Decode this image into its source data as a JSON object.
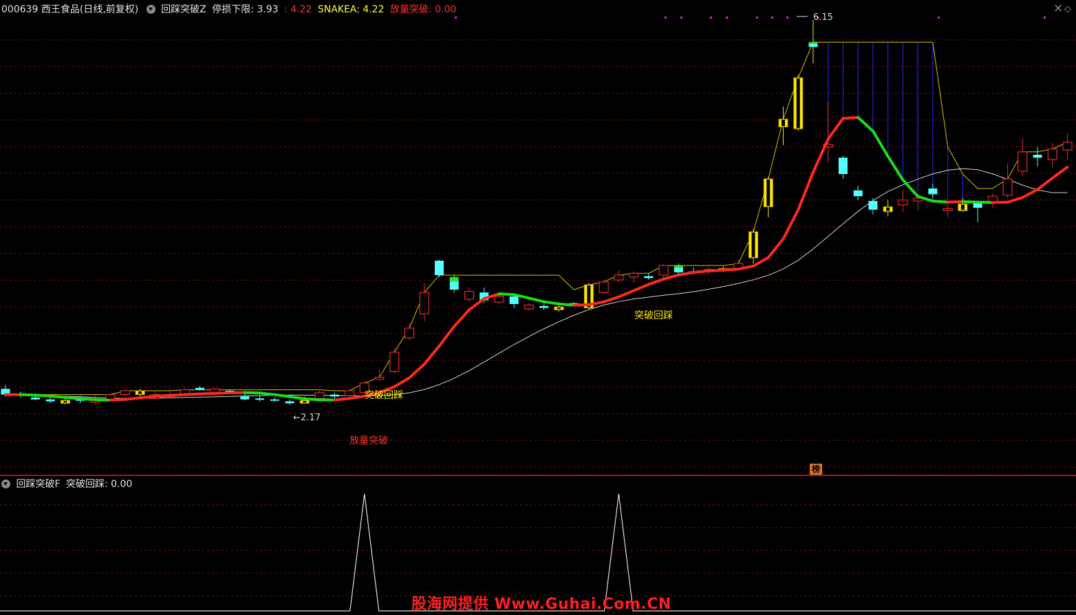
{
  "header": {
    "stock": "000639 西王食品(日线,前复权)",
    "indicator_name": "回踩突破Z",
    "stop_label": "停损下限: 3.93",
    "stop_value": ": 4.22",
    "snake_label": "SNAKEA: 4.22",
    "volume_break_label": "放量突破: 0.00"
  },
  "controls": {
    "close_icon": "×",
    "diamond_icon": "◇"
  },
  "chart_labels": {
    "high_price": "6.15",
    "low_price": "2.17",
    "break_pullback_1": "突破回踩",
    "break_pullback_2": "突破回踩",
    "volume_breakout": "放量突破"
  },
  "badge": "榜",
  "sub_header": {
    "indicator_name": "回踩突破F",
    "value_label": "突破回踩: 0.00"
  },
  "watermark": "股海网提供 Www.Guhai.Com.CN",
  "colors": {
    "up_candle": "#e8282d",
    "down_candle": "#54ffff",
    "signal_yellow": "#ffea00",
    "signal_green": "#20e830",
    "snake_red": "#ff2a1a",
    "snake_green": "#18e018",
    "slow_line": "#d8d8d8",
    "stop_line": "#d8c400",
    "fill_blue": "#2424d8",
    "grid": "#7a0f12",
    "watermark": "#ff2020"
  },
  "chart_data": {
    "type": "candlestick",
    "series": [
      {
        "name": "停损下限"
      },
      {
        "name": "SNAKEA"
      },
      {
        "name": "放量突破"
      },
      {
        "name": "突破回踩"
      }
    ],
    "annotations": {
      "max": 6.15,
      "min": 2.17
    },
    "candles": [
      {
        "o": 2.32,
        "h": 2.36,
        "l": 2.24,
        "c": 2.26,
        "k": "d"
      },
      {
        "o": 2.27,
        "h": 2.29,
        "l": 2.23,
        "c": 2.26,
        "k": "d"
      },
      {
        "o": 2.23,
        "h": 2.26,
        "l": 2.2,
        "c": 2.21,
        "k": "d"
      },
      {
        "o": 2.21,
        "h": 2.23,
        "l": 2.17,
        "c": 2.19,
        "k": "d"
      },
      {
        "o": 2.2,
        "h": 2.23,
        "l": 2.16,
        "c": 2.17,
        "k": "y"
      },
      {
        "o": 2.21,
        "h": 2.22,
        "l": 2.17,
        "c": 2.2,
        "k": "d"
      },
      {
        "o": 2.18,
        "h": 2.23,
        "l": 2.16,
        "c": 2.21,
        "k": "u"
      },
      {
        "o": 2.21,
        "h": 2.27,
        "l": 2.2,
        "c": 2.26,
        "k": "u"
      },
      {
        "o": 2.26,
        "h": 2.32,
        "l": 2.25,
        "c": 2.3,
        "k": "u"
      },
      {
        "o": 2.3,
        "h": 2.32,
        "l": 2.24,
        "c": 2.26,
        "k": "y"
      },
      {
        "o": 2.26,
        "h": 2.27,
        "l": 2.21,
        "c": 2.22,
        "k": "u"
      },
      {
        "o": 2.24,
        "h": 2.28,
        "l": 2.22,
        "c": 2.26,
        "k": "u"
      },
      {
        "o": 2.26,
        "h": 2.33,
        "l": 2.25,
        "c": 2.31,
        "k": "u"
      },
      {
        "o": 2.33,
        "h": 2.35,
        "l": 2.3,
        "c": 2.31,
        "k": "d"
      },
      {
        "o": 2.32,
        "h": 2.33,
        "l": 2.25,
        "c": 2.27,
        "k": "u"
      },
      {
        "o": 2.29,
        "h": 2.31,
        "l": 2.27,
        "c": 2.3,
        "k": "d"
      },
      {
        "o": 2.24,
        "h": 2.27,
        "l": 2.2,
        "c": 2.21,
        "k": "d"
      },
      {
        "o": 2.22,
        "h": 2.25,
        "l": 2.19,
        "c": 2.21,
        "k": "d"
      },
      {
        "o": 2.21,
        "h": 2.23,
        "l": 2.19,
        "c": 2.2,
        "k": "d"
      },
      {
        "o": 2.19,
        "h": 2.21,
        "l": 2.15,
        "c": 2.17,
        "k": "d"
      },
      {
        "o": 2.2,
        "h": 2.24,
        "l": 2.17,
        "c": 2.17,
        "k": "y"
      },
      {
        "o": 2.22,
        "h": 2.3,
        "l": 2.2,
        "c": 2.28,
        "k": "u"
      },
      {
        "o": 2.24,
        "h": 2.28,
        "l": 2.22,
        "c": 2.26,
        "k": "d"
      },
      {
        "o": 2.25,
        "h": 2.32,
        "l": 2.24,
        "c": 2.3,
        "k": "u"
      },
      {
        "o": 2.28,
        "h": 2.4,
        "l": 2.27,
        "c": 2.38,
        "k": "u"
      },
      {
        "o": 2.42,
        "h": 2.52,
        "l": 2.4,
        "c": 2.44,
        "k": "u"
      },
      {
        "o": 2.5,
        "h": 2.74,
        "l": 2.48,
        "c": 2.7,
        "k": "u"
      },
      {
        "o": 2.85,
        "h": 3.0,
        "l": 2.82,
        "c": 2.95,
        "k": "u"
      },
      {
        "o": 3.1,
        "h": 3.42,
        "l": 3.02,
        "c": 3.32,
        "k": "u"
      },
      {
        "o": 3.65,
        "h": 3.66,
        "l": 3.48,
        "c": 3.5,
        "k": "d"
      },
      {
        "o": 3.48,
        "h": 3.5,
        "l": 3.32,
        "c": 3.35,
        "k": "g"
      },
      {
        "o": 3.33,
        "h": 3.37,
        "l": 3.22,
        "c": 3.25,
        "k": "u"
      },
      {
        "o": 3.32,
        "h": 3.37,
        "l": 3.21,
        "c": 3.24,
        "k": "d"
      },
      {
        "o": 3.28,
        "h": 3.3,
        "l": 3.2,
        "c": 3.22,
        "k": "u"
      },
      {
        "o": 3.28,
        "h": 3.3,
        "l": 3.16,
        "c": 3.2,
        "k": "d"
      },
      {
        "o": 3.15,
        "h": 3.21,
        "l": 3.13,
        "c": 3.19,
        "k": "u"
      },
      {
        "o": 3.18,
        "h": 3.22,
        "l": 3.14,
        "c": 3.16,
        "k": "d"
      },
      {
        "o": 3.17,
        "h": 3.2,
        "l": 3.12,
        "c": 3.14,
        "k": "y"
      },
      {
        "o": 3.19,
        "h": 3.22,
        "l": 3.18,
        "c": 3.21,
        "k": "d"
      },
      {
        "o": 3.16,
        "h": 3.42,
        "l": 3.15,
        "c": 3.4,
        "k": "y"
      },
      {
        "o": 3.32,
        "h": 3.45,
        "l": 3.3,
        "c": 3.43,
        "k": "u"
      },
      {
        "o": 3.45,
        "h": 3.55,
        "l": 3.42,
        "c": 3.5,
        "k": "u"
      },
      {
        "o": 3.48,
        "h": 3.54,
        "l": 3.42,
        "c": 3.52,
        "k": "u"
      },
      {
        "o": 3.49,
        "h": 3.52,
        "l": 3.45,
        "c": 3.47,
        "k": "d"
      },
      {
        "o": 3.5,
        "h": 3.62,
        "l": 3.46,
        "c": 3.6,
        "k": "u"
      },
      {
        "o": 3.53,
        "h": 3.62,
        "l": 3.5,
        "c": 3.6,
        "k": "g"
      },
      {
        "o": 3.54,
        "h": 3.58,
        "l": 3.51,
        "c": 3.53,
        "k": "d"
      },
      {
        "o": 3.56,
        "h": 3.58,
        "l": 3.51,
        "c": 3.54,
        "k": "u"
      },
      {
        "o": 3.55,
        "h": 3.59,
        "l": 3.53,
        "c": 3.57,
        "k": "y"
      },
      {
        "o": 3.56,
        "h": 3.66,
        "l": 3.55,
        "c": 3.62,
        "k": "u"
      },
      {
        "o": 3.68,
        "h": 3.98,
        "l": 3.62,
        "c": 3.95,
        "k": "y"
      },
      {
        "o": 4.21,
        "h": 4.52,
        "l": 4.1,
        "c": 4.5,
        "k": "y"
      },
      {
        "o": 5.04,
        "h": 5.25,
        "l": 4.85,
        "c": 5.12,
        "k": "y"
      },
      {
        "o": 5.02,
        "h": 5.58,
        "l": 5.0,
        "c": 5.55,
        "k": "y"
      },
      {
        "o": 5.87,
        "h": 6.15,
        "l": 5.7,
        "c": 5.92,
        "k": "g"
      },
      {
        "o": 4.86,
        "h": 5.3,
        "l": 4.67,
        "c": 4.83,
        "k": "u"
      },
      {
        "o": 4.72,
        "h": 4.74,
        "l": 4.5,
        "c": 4.55,
        "k": "d"
      },
      {
        "o": 4.38,
        "h": 4.43,
        "l": 4.28,
        "c": 4.32,
        "k": "d"
      },
      {
        "o": 4.27,
        "h": 4.3,
        "l": 4.13,
        "c": 4.18,
        "k": "d"
      },
      {
        "o": 4.21,
        "h": 4.28,
        "l": 4.11,
        "c": 4.16,
        "k": "y"
      },
      {
        "o": 4.23,
        "h": 4.38,
        "l": 4.16,
        "c": 4.28,
        "k": "u"
      },
      {
        "o": 4.27,
        "h": 4.33,
        "l": 4.17,
        "c": 4.3,
        "k": "u"
      },
      {
        "o": 4.34,
        "h": 4.45,
        "l": 4.3,
        "c": 4.4,
        "k": "d"
      },
      {
        "o": 4.19,
        "h": 4.25,
        "l": 4.1,
        "c": 4.17,
        "k": "u"
      },
      {
        "o": 4.24,
        "h": 4.3,
        "l": 4.16,
        "c": 4.17,
        "k": "y"
      },
      {
        "o": 4.25,
        "h": 4.27,
        "l": 4.05,
        "c": 4.2,
        "k": "d"
      },
      {
        "o": 4.25,
        "h": 4.35,
        "l": 4.2,
        "c": 4.32,
        "k": "u"
      },
      {
        "o": 4.33,
        "h": 4.66,
        "l": 4.3,
        "c": 4.5,
        "k": "u"
      },
      {
        "o": 4.58,
        "h": 4.92,
        "l": 4.53,
        "c": 4.78,
        "k": "u"
      },
      {
        "o": 4.75,
        "h": 4.83,
        "l": 4.63,
        "c": 4.72,
        "k": "d"
      },
      {
        "o": 4.7,
        "h": 4.87,
        "l": 4.62,
        "c": 4.81,
        "k": "u"
      },
      {
        "o": 4.8,
        "h": 4.97,
        "l": 4.7,
        "c": 4.88,
        "k": "u"
      }
    ],
    "signal_x": [
      24,
      41
    ]
  }
}
